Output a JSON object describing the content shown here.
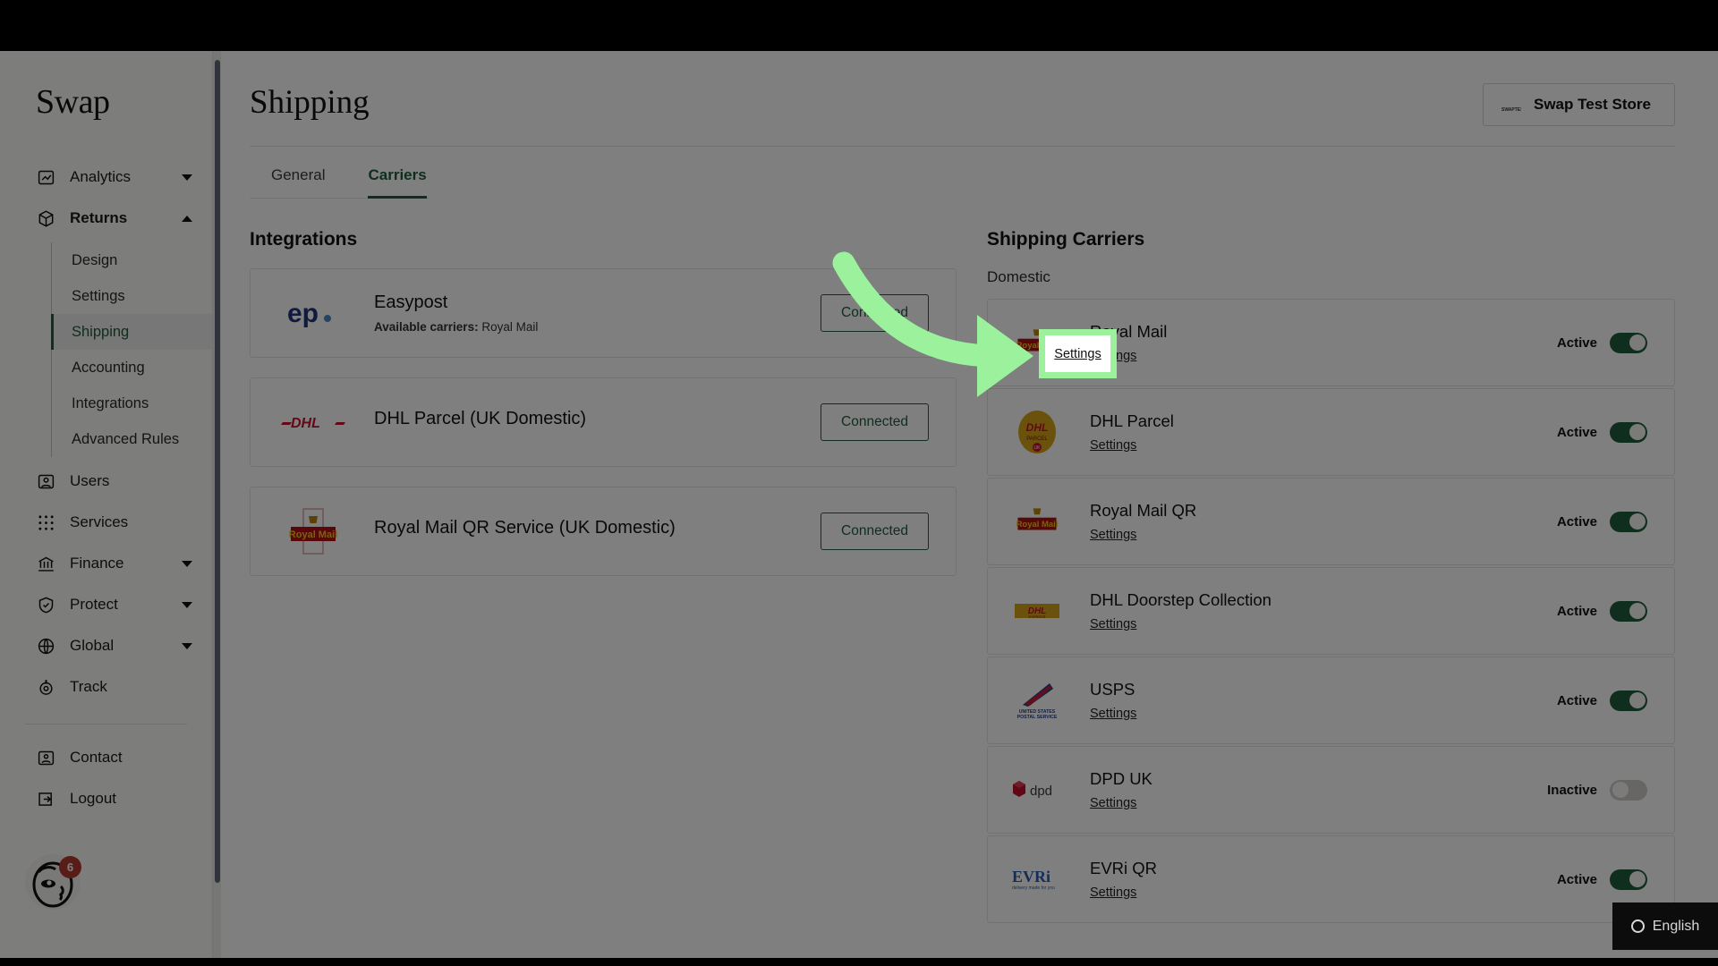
{
  "brand": {
    "name": "Swap"
  },
  "sidebar": {
    "items": [
      {
        "label": "Analytics",
        "icon": "analytics-chart-icon",
        "caret": "down",
        "bold": false
      },
      {
        "label": "Returns",
        "icon": "package-box-icon",
        "caret": "up",
        "bold": true
      }
    ],
    "returns_sub": [
      {
        "label": "Design",
        "active": false
      },
      {
        "label": "Settings",
        "active": false
      },
      {
        "label": "Shipping",
        "active": true
      },
      {
        "label": "Accounting",
        "active": false
      },
      {
        "label": "Integrations",
        "active": false
      },
      {
        "label": "Advanced Rules",
        "active": false
      }
    ],
    "items_lower": [
      {
        "label": "Users",
        "icon": "user-card-icon",
        "caret": "",
        "bold": false
      },
      {
        "label": "Services",
        "icon": "grid-dots-icon",
        "caret": "",
        "bold": false
      },
      {
        "label": "Finance",
        "icon": "bank-icon",
        "caret": "down",
        "bold": false
      },
      {
        "label": "Protect",
        "icon": "shield-check-icon",
        "caret": "down",
        "bold": false
      },
      {
        "label": "Global",
        "icon": "globe-icon",
        "caret": "down",
        "bold": false
      },
      {
        "label": "Track",
        "icon": "track-target-icon",
        "caret": "",
        "bold": false
      }
    ],
    "footer": [
      {
        "label": "Contact",
        "icon": "contact-card-icon",
        "badge": "6"
      },
      {
        "label": "Logout",
        "icon": "logout-arrow-icon",
        "badge": ""
      }
    ]
  },
  "header": {
    "title": "Shipping",
    "store_button": "Swap Test Store"
  },
  "tabs": [
    {
      "label": "General",
      "active": false
    },
    {
      "label": "Carriers",
      "active": true
    }
  ],
  "integrations": {
    "title": "Integrations",
    "cards": [
      {
        "name": "Easypost",
        "meta_label": "Available carriers:",
        "meta_value": "Royal Mail",
        "status": "Connected",
        "logo": "easypost-logo"
      },
      {
        "name": "DHL Parcel (UK Domestic)",
        "meta_label": "",
        "meta_value": "",
        "status": "Connected",
        "logo": "dhl-red-logo"
      },
      {
        "name": "Royal Mail QR Service (UK Domestic)",
        "meta_label": "",
        "meta_value": "",
        "status": "Connected",
        "logo": "royal-mail-logo"
      }
    ]
  },
  "carriers": {
    "title": "Shipping Carriers",
    "group_label": "Domestic",
    "settings_label": "Settings",
    "rows": [
      {
        "name": "Royal Mail",
        "logo": "royal-mail-logo",
        "state": "Active",
        "on": true
      },
      {
        "name": "DHL Parcel",
        "logo": "dhl-yellow-logo",
        "state": "Active",
        "on": true
      },
      {
        "name": "Royal Mail QR",
        "logo": "royal-mail-logo",
        "state": "Active",
        "on": true
      },
      {
        "name": "DHL Doorstep Collection",
        "logo": "dhl-yellow-logo",
        "state": "Active",
        "on": true
      },
      {
        "name": "USPS",
        "logo": "usps-logo",
        "state": "Active",
        "on": true
      },
      {
        "name": "DPD UK",
        "logo": "dpd-logo",
        "state": "Inactive",
        "on": false
      },
      {
        "name": "EVRi QR",
        "logo": "evri-logo",
        "state": "Active",
        "on": true
      }
    ]
  },
  "annotation": {
    "highlight_label": "Settings",
    "arrow_icon": "green-curved-arrow",
    "highlight_color": "#9cf29c"
  },
  "language_widget": {
    "label": "English",
    "icon": "language-ring-icon"
  },
  "colors": {
    "accent_green": "#1f5c3d",
    "badge_red": "#b03a2e",
    "highlight_green": "#9cf29c",
    "sidebar_bg": "#fafaf9"
  }
}
